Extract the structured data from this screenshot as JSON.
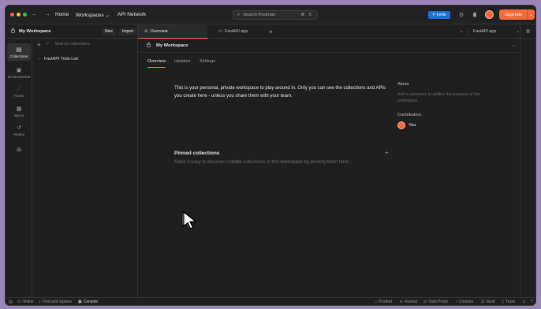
{
  "titlebar": {
    "home": "Home",
    "workspaces": "Workspaces",
    "api_network": "API Network",
    "search_placeholder": "Search Postman",
    "search_shortcut": "⌘ K",
    "invite": "Invite",
    "upgrade": "Upgrade"
  },
  "workspace": {
    "name": "My Workspace",
    "new": "New",
    "import": "Import"
  },
  "rail": {
    "items": [
      {
        "label": "Collections"
      },
      {
        "label": "Environments"
      },
      {
        "label": "Flows"
      },
      {
        "label": "Specs"
      },
      {
        "label": "History"
      }
    ]
  },
  "collections": {
    "search_placeholder": "Search collections",
    "items": [
      "FastAPI Todo List"
    ]
  },
  "tabs": {
    "overview": "Overview",
    "fastapi": "FastAPI app",
    "environment": "FastAPI app"
  },
  "main": {
    "title": "My Workspace",
    "subtabs": [
      "Overview",
      "Updates",
      "Settings"
    ],
    "intro": "This is your personal, private workspace to play around in. Only you can see the collections and APIs you create here - unless you share them with your team.",
    "about_heading": "About",
    "about_placeholder": "Add a summary to outline the purpose of this workspace.",
    "contributors_heading": "Contributors",
    "contributor": "You",
    "pinned_heading": "Pinned collections",
    "pinned_text": "Make it easy to discover notable collections in this workspace by pinning them here."
  },
  "status": {
    "online": "Online",
    "find_replace": "Find and replace",
    "console": "Console",
    "postbot": "Postbot",
    "runner": "Runner",
    "start_proxy": "Start Proxy",
    "cookies": "Cookies",
    "vault": "Vault",
    "trash": "Trash"
  },
  "colors": {
    "accent": "#f26b3a",
    "invite": "#1e6fd9",
    "background": "#1f1f1f"
  }
}
